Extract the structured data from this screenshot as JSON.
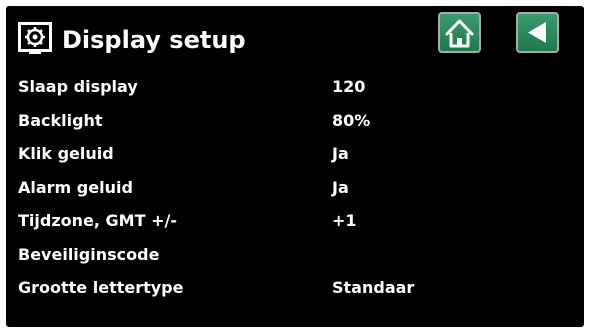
{
  "header": {
    "title": "Display setup",
    "title_icon": "monitor-settings-icon",
    "home_icon": "home-icon",
    "back_icon": "back-arrow-icon"
  },
  "settings": [
    {
      "label": "Slaap display",
      "value": "120"
    },
    {
      "label": "Backlight",
      "value": "80%"
    },
    {
      "label": "Klik geluid",
      "value": "Ja"
    },
    {
      "label": "Alarm geluid",
      "value": "Ja"
    },
    {
      "label": "Tijdzone, GMT +/-",
      "value": "+1"
    },
    {
      "label": "Beveiliginscode",
      "value": ""
    },
    {
      "label": "Grootte lettertype",
      "value": "Standaar"
    }
  ],
  "colors": {
    "background": "#000000",
    "text": "#ffffff",
    "button_green": "#2a8a5a"
  }
}
